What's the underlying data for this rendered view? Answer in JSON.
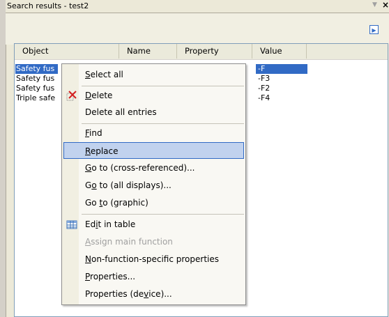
{
  "panel": {
    "title": "Search results - test2",
    "pin_icon": "pin-icon",
    "close_icon": "close-icon"
  },
  "columns": [
    "Object",
    "Name",
    "Property",
    "Value"
  ],
  "rows": [
    {
      "object": "Safety fuse",
      "object_visible": "Safety fus",
      "value": "-F",
      "selected": true
    },
    {
      "object": "Safety fuse",
      "object_visible": "Safety fus",
      "value": "-F3",
      "selected": false
    },
    {
      "object": "Safety fuse",
      "object_visible": "Safety fus",
      "value": "-F2",
      "selected": false
    },
    {
      "object": "Triple safety fuse",
      "object_visible": "Triple safe",
      "value": "-F4",
      "selected": false
    }
  ],
  "menu": {
    "items": [
      {
        "pre": "",
        "ul": "S",
        "post": "elect all",
        "disabled": false
      },
      {
        "pre": "",
        "ul": "D",
        "post": "elete",
        "icon": "delete-icon",
        "disabled": false
      },
      {
        "pre": "Delete all entries",
        "ul": "",
        "post": "",
        "disabled": false
      },
      {
        "pre": "",
        "ul": "F",
        "post": "ind",
        "disabled": false
      },
      {
        "pre": "",
        "ul": "R",
        "post": "eplace",
        "hover": true,
        "disabled": false
      },
      {
        "pre": "",
        "ul": "G",
        "post": "o to (cross-referenced)...",
        "disabled": false
      },
      {
        "pre": "G",
        "ul": "o",
        "post": " to (all displays)...",
        "disabled": false
      },
      {
        "pre": "Go ",
        "ul": "t",
        "post": "o (graphic)",
        "disabled": false
      },
      {
        "pre": "Ed",
        "ul": "i",
        "post": "t in table",
        "icon": "table-icon",
        "disabled": false
      },
      {
        "pre": "",
        "ul": "A",
        "post": "ssign main function",
        "disabled": true
      },
      {
        "pre": "",
        "ul": "N",
        "post": "on-function-specific properties",
        "disabled": false
      },
      {
        "pre": "",
        "ul": "P",
        "post": "roperties...",
        "disabled": false
      },
      {
        "pre": "Properties (de",
        "ul": "v",
        "post": "ice)...",
        "disabled": false
      }
    ]
  }
}
